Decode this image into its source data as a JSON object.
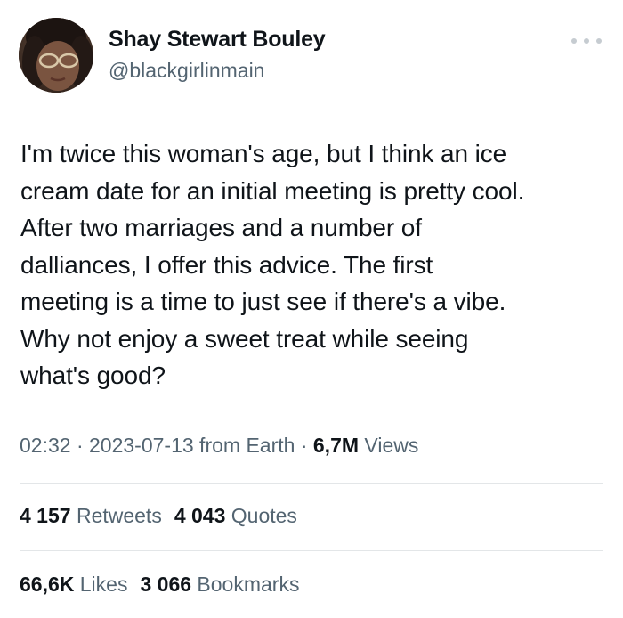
{
  "author": {
    "name": "Shay Stewart Bouley",
    "handle": "@blackgirlinmain"
  },
  "tweet": {
    "lines": [
      "I'm twice this woman's age, but I think an ice",
      "cream date for an initial meeting is pretty cool.",
      "After two marriages and a number of",
      "dalliances, I offer this advice. The first",
      "meeting is a time to just see if there's a vibe.",
      "Why not enjoy a sweet treat while seeing",
      "what's good?"
    ]
  },
  "meta": {
    "time": "02:32",
    "separator": " · ",
    "date": "2023-07-13",
    "source": " from Earth",
    "views_count": "6,7M",
    "views_label": " Views"
  },
  "stats": {
    "retweets_count": "4 157",
    "retweets_label": " Retweets",
    "quotes_count": "4 043",
    "quotes_label": " Quotes",
    "likes_count": "66,6K",
    "likes_label": " Likes",
    "bookmarks_count": "3 066",
    "bookmarks_label": " Bookmarks"
  },
  "icons": {
    "more": "more-options-icon"
  },
  "colors": {
    "text": "#0f1419",
    "secondary": "#536471",
    "divider": "#e3e6e8"
  }
}
